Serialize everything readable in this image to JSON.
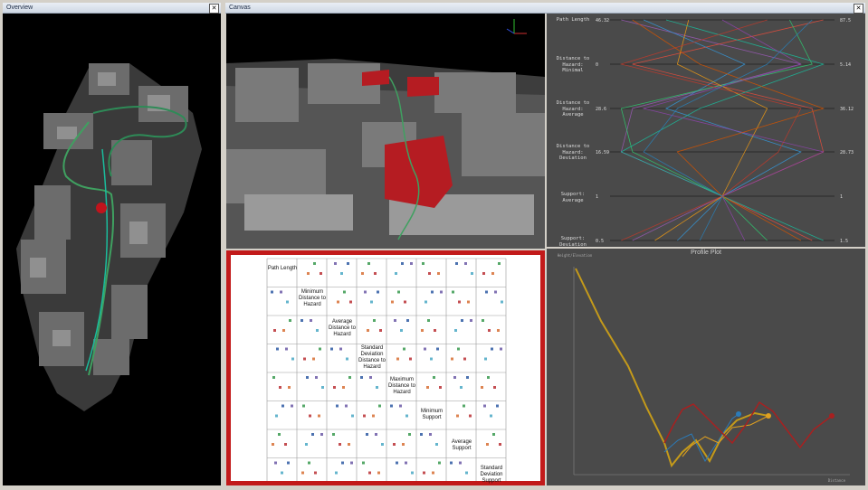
{
  "windows": {
    "overview": {
      "title": "Overview",
      "close": "✕"
    },
    "canvas": {
      "title": "Canvas",
      "close": "✕"
    }
  },
  "parallel": {
    "axes": [
      {
        "label": "Path Length",
        "min": "46.32",
        "max": "87.5"
      },
      {
        "label": "Distance to\nHazard:\nMinimal",
        "min": "0",
        "max": "5.14"
      },
      {
        "label": "Distance to\nHazard:\nAverage",
        "min": "28.6",
        "max": "36.12"
      },
      {
        "label": "Distance to\nHazard:\nDeviation",
        "min": "16.59",
        "max": "28.73"
      },
      {
        "label": "Support:\nAverage",
        "min": "1",
        "max": "1"
      },
      {
        "label": "Support:\nDeviation",
        "min": "0.5",
        "max": "1.5"
      }
    ],
    "line_colors": [
      "#9b59b6",
      "#e74c3c",
      "#3498db",
      "#2ecc71",
      "#f39c12",
      "#1abc9c",
      "#c0392b",
      "#8e44ad",
      "#d35400",
      "#2980b9"
    ]
  },
  "matrix": {
    "labels": [
      "Path Length",
      "Minimum\nDistance to\nHazard",
      "Average\nDistance to\nHazard",
      "Standard\nDeviation\nDistance to\nHazard",
      "Maximum\nDistance to\nHazard",
      "Minimum\nSupport",
      "Average\nSupport",
      "Standard\nDeviation\nSupport"
    ],
    "dot_colors": [
      "#4c72b0",
      "#dd8452",
      "#55a868",
      "#c44e52",
      "#8172b3",
      "#64b5cd"
    ]
  },
  "profile": {
    "title": "Profile Plot",
    "xlabel": "Distance",
    "ylabel": "Height/Elevation",
    "series_colors": [
      "#c49a1a",
      "#2b7bb9",
      "#e0a020",
      "#a82020"
    ]
  }
}
